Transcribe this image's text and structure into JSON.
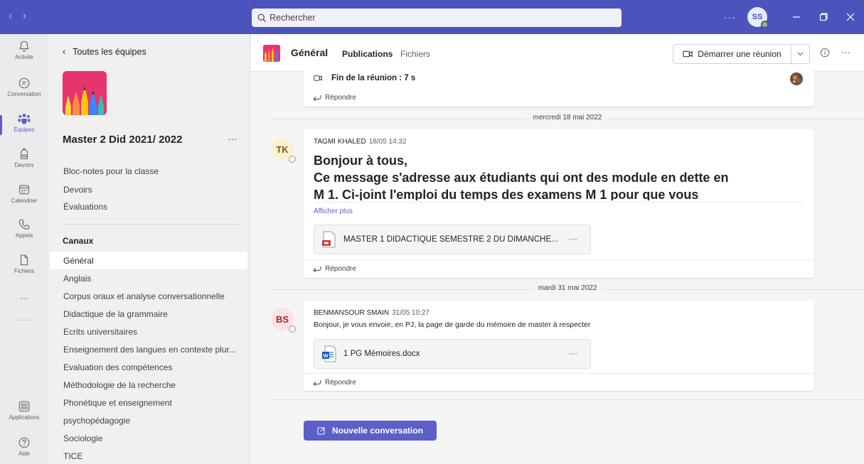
{
  "titlebar": {
    "search_placeholder": "Rechercher",
    "more_label": "···",
    "user_initials": "SS"
  },
  "rail": {
    "items": [
      {
        "label": "Activité",
        "icon": "bell-icon"
      },
      {
        "label": "Conversation",
        "icon": "chat-icon"
      },
      {
        "label": "Équipes",
        "icon": "teams-icon"
      },
      {
        "label": "Devoirs",
        "icon": "backpack-icon"
      },
      {
        "label": "Calendrier",
        "icon": "calendar-icon"
      },
      {
        "label": "Appels",
        "icon": "phone-icon"
      },
      {
        "label": "Fichiers",
        "icon": "file-icon"
      },
      {
        "label": "···",
        "icon": "more-icon"
      }
    ],
    "bottom": [
      {
        "label": "Applications",
        "icon": "apps-icon"
      },
      {
        "label": "Aide",
        "icon": "help-icon"
      }
    ]
  },
  "panel": {
    "back_label": "Toutes les équipes",
    "team_name": "Master 2 Did 2021/ 2022",
    "team_more": "···",
    "links": [
      "Bloc-notes pour la classe",
      "Devoirs",
      "Évaluations"
    ],
    "channels_title": "Canaux",
    "channels": [
      "Général",
      "Anglais",
      "Corpus oraux et analyse conversationnelle",
      "Didactique de la grammaire",
      "Ecrits universitaires",
      "Enseignement des langues en contexte plur...",
      "Evaluation des compétences",
      "Méthodologie de la recherche",
      "Phonétique et enseignement",
      "psychopédagogie",
      "Sociologie",
      "TICE"
    ]
  },
  "channel_header": {
    "title": "Général",
    "tabs": [
      "Publications",
      "Fichiers"
    ],
    "meet_label": "Démarrer une réunion",
    "more_label": "···"
  },
  "feed": {
    "meeting_end": "Fin de la réunion : 7 s",
    "reply_label": "Répondre",
    "date1": "mercredi 18 mai 2022",
    "date2": "mardi 31 mai 2022",
    "post1": {
      "initials": "TK",
      "author": "TAGMI KHALED",
      "time": "18/05 14:32",
      "line1": "Bonjour à tous,",
      "line2": "Ce message s'adresse aux étudiants qui ont des module en dette en",
      "line3": "M 1. Ci-joint l'emploi du temps des examens M 1 pour que vous",
      "show_more": "Afficher plus",
      "attachment": "MASTER 1 DIDACTIQUE SEMESTRE 2 DU DIMANCHE...",
      "attach_more": "···"
    },
    "post2": {
      "initials": "BS",
      "author": "BENMANSOUR SMAIN",
      "time": "31/05 10:27",
      "text": "Bonjour, je vous envoie, en PJ, la page de garde du mémoire de master à respecter",
      "attachment": "1 PG Mémoires.docx",
      "attach_more": "···"
    },
    "new_conversation": "Nouvelle conversation"
  },
  "colors": {
    "brand": "#4b53bc",
    "accent": "#5b5fc7",
    "avatar_tk_bg": "#fbf0d1",
    "avatar_tk_fg": "#8a5a00",
    "avatar_bs_bg": "#fce3e3",
    "avatar_bs_fg": "#a4262c",
    "team_image_bg": "#e8346e"
  }
}
